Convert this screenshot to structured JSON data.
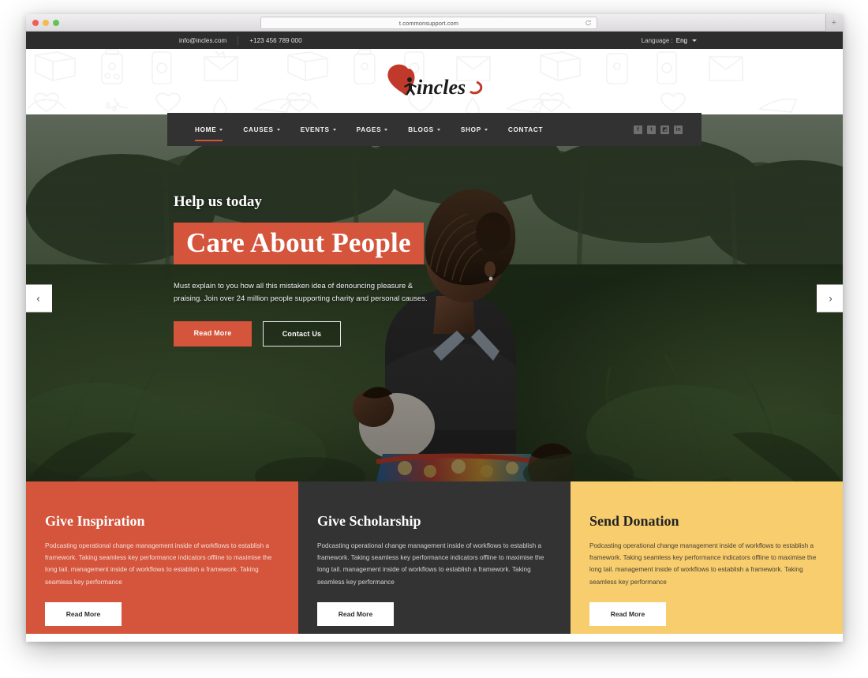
{
  "browser": {
    "url": "t.commonsupport.com",
    "reload_icon": "reload-icon",
    "new_tab_icon": "plus-icon",
    "traffic_lights": [
      "close-red",
      "minimize-yellow",
      "maximize-green"
    ]
  },
  "topbar": {
    "email": "info@incles.com",
    "phone": "+123 456 789 000",
    "language_label": "Language :",
    "language_value": "Eng",
    "caret_icon": "chevron-down-icon"
  },
  "logo": {
    "text": "incles",
    "heart_icon": "heart-icon",
    "person_icon": "person-icon",
    "heart_color": "#c0392b",
    "text_color": "#1b1b1b"
  },
  "nav": {
    "items": [
      {
        "label": "HOME",
        "has_caret": true,
        "active": true
      },
      {
        "label": "CAUSES",
        "has_caret": true,
        "active": false
      },
      {
        "label": "EVENTS",
        "has_caret": true,
        "active": false
      },
      {
        "label": "PAGES",
        "has_caret": true,
        "active": false
      },
      {
        "label": "BLOGS",
        "has_caret": true,
        "active": false
      },
      {
        "label": "SHOP",
        "has_caret": true,
        "active": false
      },
      {
        "label": "CONTACT",
        "has_caret": false,
        "active": false
      }
    ],
    "social": [
      {
        "name": "facebook-icon",
        "glyph": "f"
      },
      {
        "name": "twitter-icon",
        "glyph": "t"
      },
      {
        "name": "instagram-icon",
        "glyph": "◩"
      },
      {
        "name": "linkedin-icon",
        "glyph": "in"
      }
    ],
    "active_underline_color": "#d8533c",
    "background_color": "#323232"
  },
  "hero": {
    "kicker": "Help us today",
    "title": "Care About People",
    "title_bg_color": "#d4543c",
    "description": "Must explain to you how all this mistaken idea of denouncing pleasure & praising. Join over 24 million people supporting charity and personal causes.",
    "buttons": [
      {
        "label": "Read More",
        "style": "primary"
      },
      {
        "label": "Contact Us",
        "style": "outline"
      }
    ],
    "prev_arrow": "‹",
    "next_arrow": "›"
  },
  "cards": [
    {
      "title": "Give Inspiration",
      "text": "Podcasting operational change management inside of workflows to establish a framework. Taking seamless key performance indicators offline to maximise the long tail. management inside of workflows to establish a framework. Taking seamless key performance",
      "button": "Read More",
      "bg_color": "#d4543c"
    },
    {
      "title": "Give Scholarship",
      "text": "Podcasting operational change management inside of workflows to establish a framework. Taking seamless key performance indicators offline to maximise the long tail. management inside of workflows to establish a framework. Taking seamless key performance",
      "button": "Read More",
      "bg_color": "#333333"
    },
    {
      "title": "Send Donation",
      "text": "Podcasting operational change management inside of workflows to establish a framework. Taking seamless key performance indicators offline to maximise the long tail. management inside of workflows to establish a framework. Taking seamless key performance",
      "button": "Read More",
      "bg_color": "#f7cd6e"
    }
  ]
}
